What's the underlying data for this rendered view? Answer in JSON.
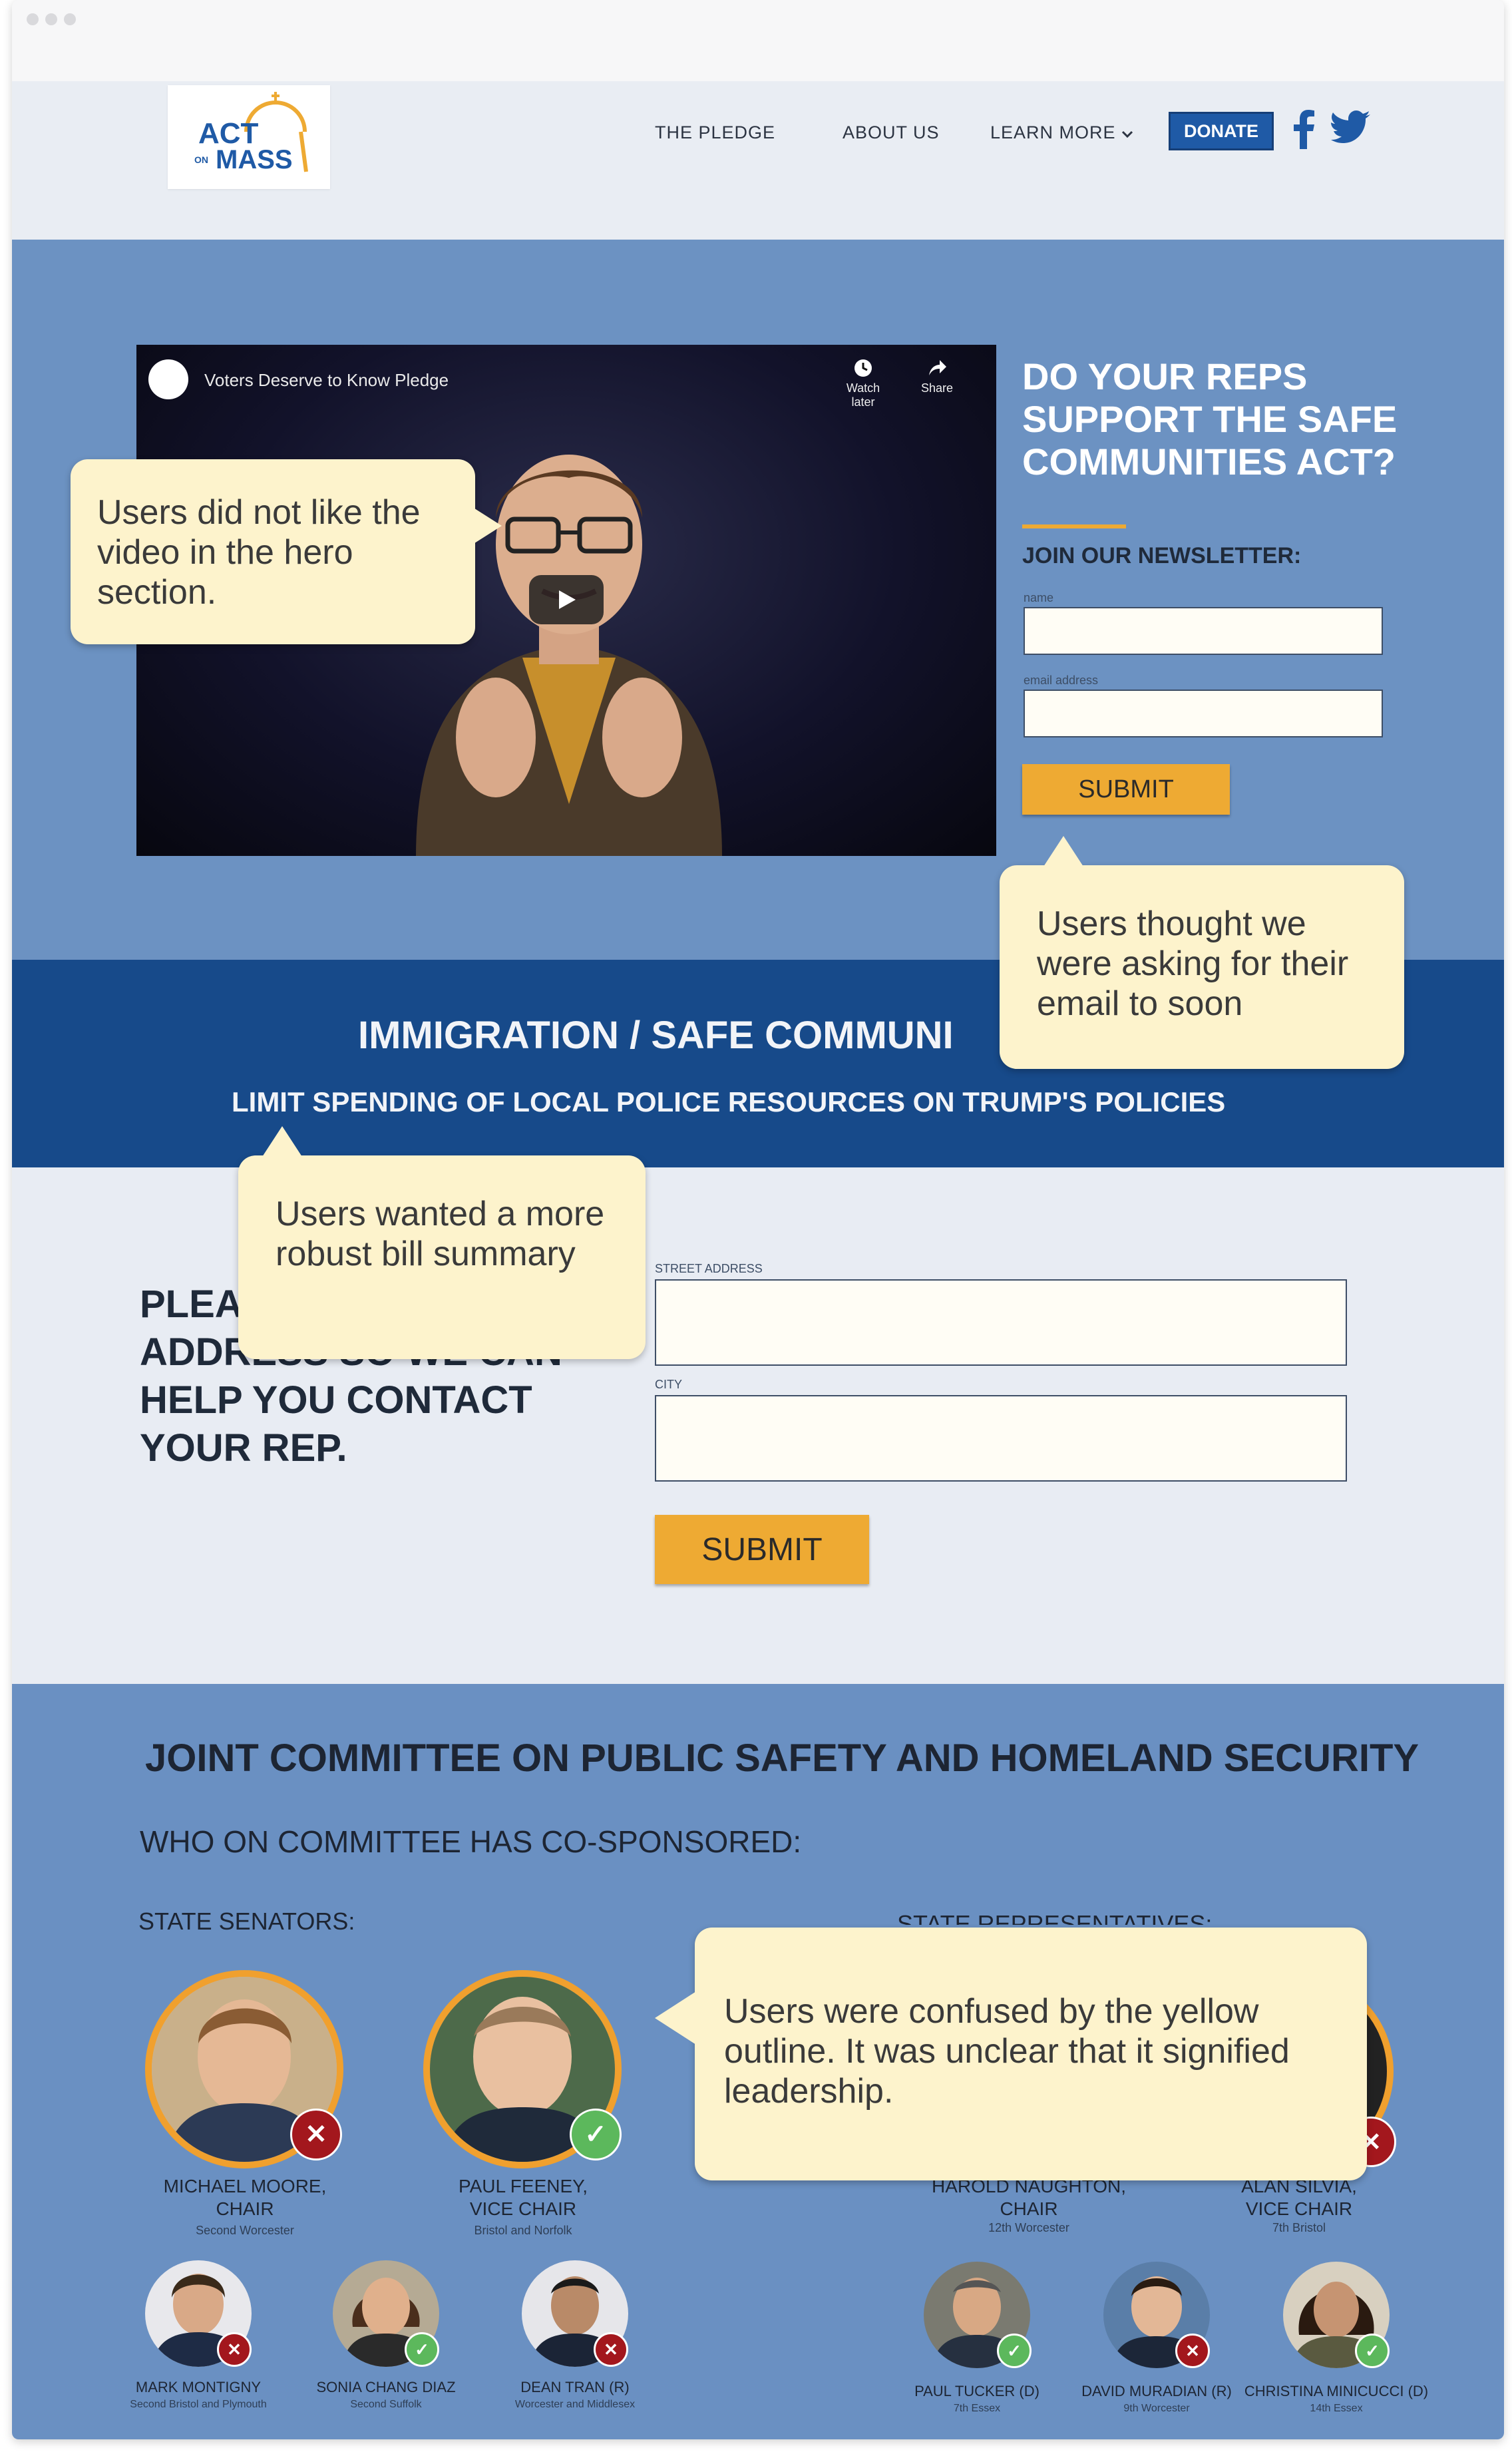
{
  "header": {
    "logo": {
      "line1": "ACT",
      "on": "ON",
      "line2": "MASS"
    },
    "nav": [
      "THE PLEDGE",
      "ABOUT US",
      "LEARN MORE"
    ],
    "dropdown_icon": "chevron-down-icon",
    "donate_label": "DONATE",
    "social": [
      "facebook-icon",
      "twitter-icon"
    ]
  },
  "hero": {
    "video": {
      "title": "Voters Deserve to Know Pledge",
      "watch_later": "Watch later",
      "share": "Share"
    },
    "headline": "DO YOUR REPS SUPPORT THE SAFE COMMUNITIES ACT?",
    "newsletter": {
      "label": "JOIN OUR NEWSLETTER:",
      "name_label": "name",
      "email_label": "email address",
      "name_value": "",
      "email_value": "",
      "submit_label": "SUBMIT"
    }
  },
  "band": {
    "title": "IMMIGRATION / SAFE COMMUNI",
    "subtitle": "LIMIT SPENDING OF LOCAL POLICE RESOURCES ON TRUMP'S POLICIES"
  },
  "address": {
    "prompt_lines": [
      "PLEA",
      "ADDRESS SO WE CAN",
      "HELP YOU CONTACT",
      "YOUR REP."
    ],
    "street_label": "STREET ADDRESS",
    "city_label": "CITY",
    "street_value": "",
    "city_value": "",
    "submit_label": "SUBMIT"
  },
  "committee": {
    "title": "JOINT COMMITTEE ON PUBLIC SAFETY AND HOMELAND SECURITY",
    "question": "WHO ON COMMITTEE HAS CO-SPONSORED:",
    "senators_label": "STATE SENATORS:",
    "reps_label": "STATE REPRESENTATIVES:",
    "senators_leaders": [
      {
        "name": "MICHAEL MOORE,",
        "role": "CHAIR",
        "district": "Second Worcester",
        "status": "no"
      },
      {
        "name": "PAUL FEENEY,",
        "role": "VICE CHAIR",
        "district": "Bristol and Norfolk",
        "status": "yes"
      }
    ],
    "reps_leaders": [
      {
        "name": "HAROLD NAUGHTON,",
        "role": "CHAIR",
        "district": "12th Worcester"
      },
      {
        "name": "ALAN SILVIA,",
        "role": "VICE CHAIR",
        "district": "7th Bristol",
        "status": "no"
      }
    ],
    "senators": [
      {
        "name": "MARK MONTIGNY",
        "district": "Second Bristol and Plymouth",
        "status": "no"
      },
      {
        "name": "SONIA CHANG DIAZ",
        "district": "Second Suffolk",
        "status": "yes"
      },
      {
        "name": "DEAN TRAN (R)",
        "district": "Worcester and Middlesex",
        "status": "no"
      }
    ],
    "reps": [
      {
        "name": "PAUL TUCKER (D)",
        "district": "7th Essex",
        "status": "yes"
      },
      {
        "name": "DAVID MURADIAN (R)",
        "district": "9th Worcester",
        "status": "no"
      },
      {
        "name": "CHRISTINA MINICUCCI (D)",
        "district": "14th Essex",
        "status": "yes"
      }
    ]
  },
  "callouts": [
    "Users did not like the video in the hero section.",
    "Users thought we were asking for their email to soon",
    "Users wanted a more robust bill summary",
    "Users were confused by the yellow outline. It was unclear that it signified leadership."
  ],
  "colors": {
    "hero_bg": "#6c92c2",
    "band_bg": "#174a8a",
    "accent": "#eeaa33",
    "donate": "#1f5aa6",
    "callout_bg": "#fdf3cc",
    "no_badge": "#a3171d",
    "yes_badge": "#5cb85c"
  }
}
